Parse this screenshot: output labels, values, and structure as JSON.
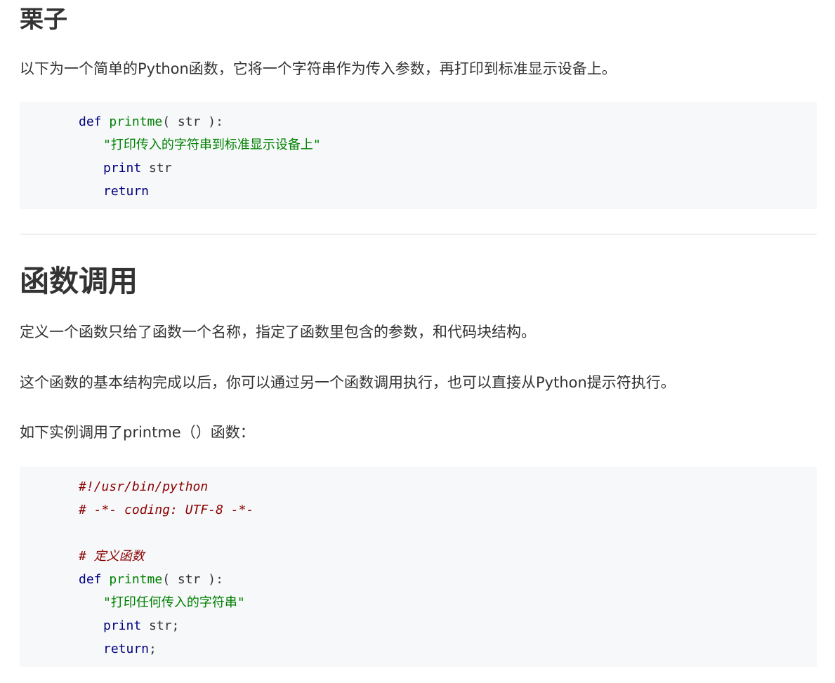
{
  "section_example": {
    "heading": "栗子",
    "intro": "以下为一个简单的Python函数，它将一个字符串作为传入参数，再打印到标准显示设备上。",
    "code": {
      "l1_kw": "def",
      "l1_fn": "printme",
      "l1_rest": "( str ):",
      "l2_str": "\"打印传入的字符串到标准显示设备上\"",
      "l3_kw": "print",
      "l3_rest": " str",
      "l4_kw": "return"
    }
  },
  "section_call": {
    "heading": "函数调用",
    "p1": "定义一个函数只给了函数一个名称，指定了函数里包含的参数，和代码块结构。",
    "p2": "这个函数的基本结构完成以后，你可以通过另一个函数调用执行，也可以直接从Python提示符执行。",
    "p3": "如下实例调用了printme（）函数：",
    "code": {
      "c1": "#!/usr/bin/python",
      "c2": "# -*- coding: UTF-8 -*-",
      "c3": "# 定义函数",
      "l5_kw": "def",
      "l5_fn": "printme",
      "l5_rest": "( str ):",
      "l6_str": "\"打印任何传入的字符串\"",
      "l7_kw": "print",
      "l7_rest": " str;",
      "l8_kw": "return",
      "l8_rest": ";"
    }
  }
}
